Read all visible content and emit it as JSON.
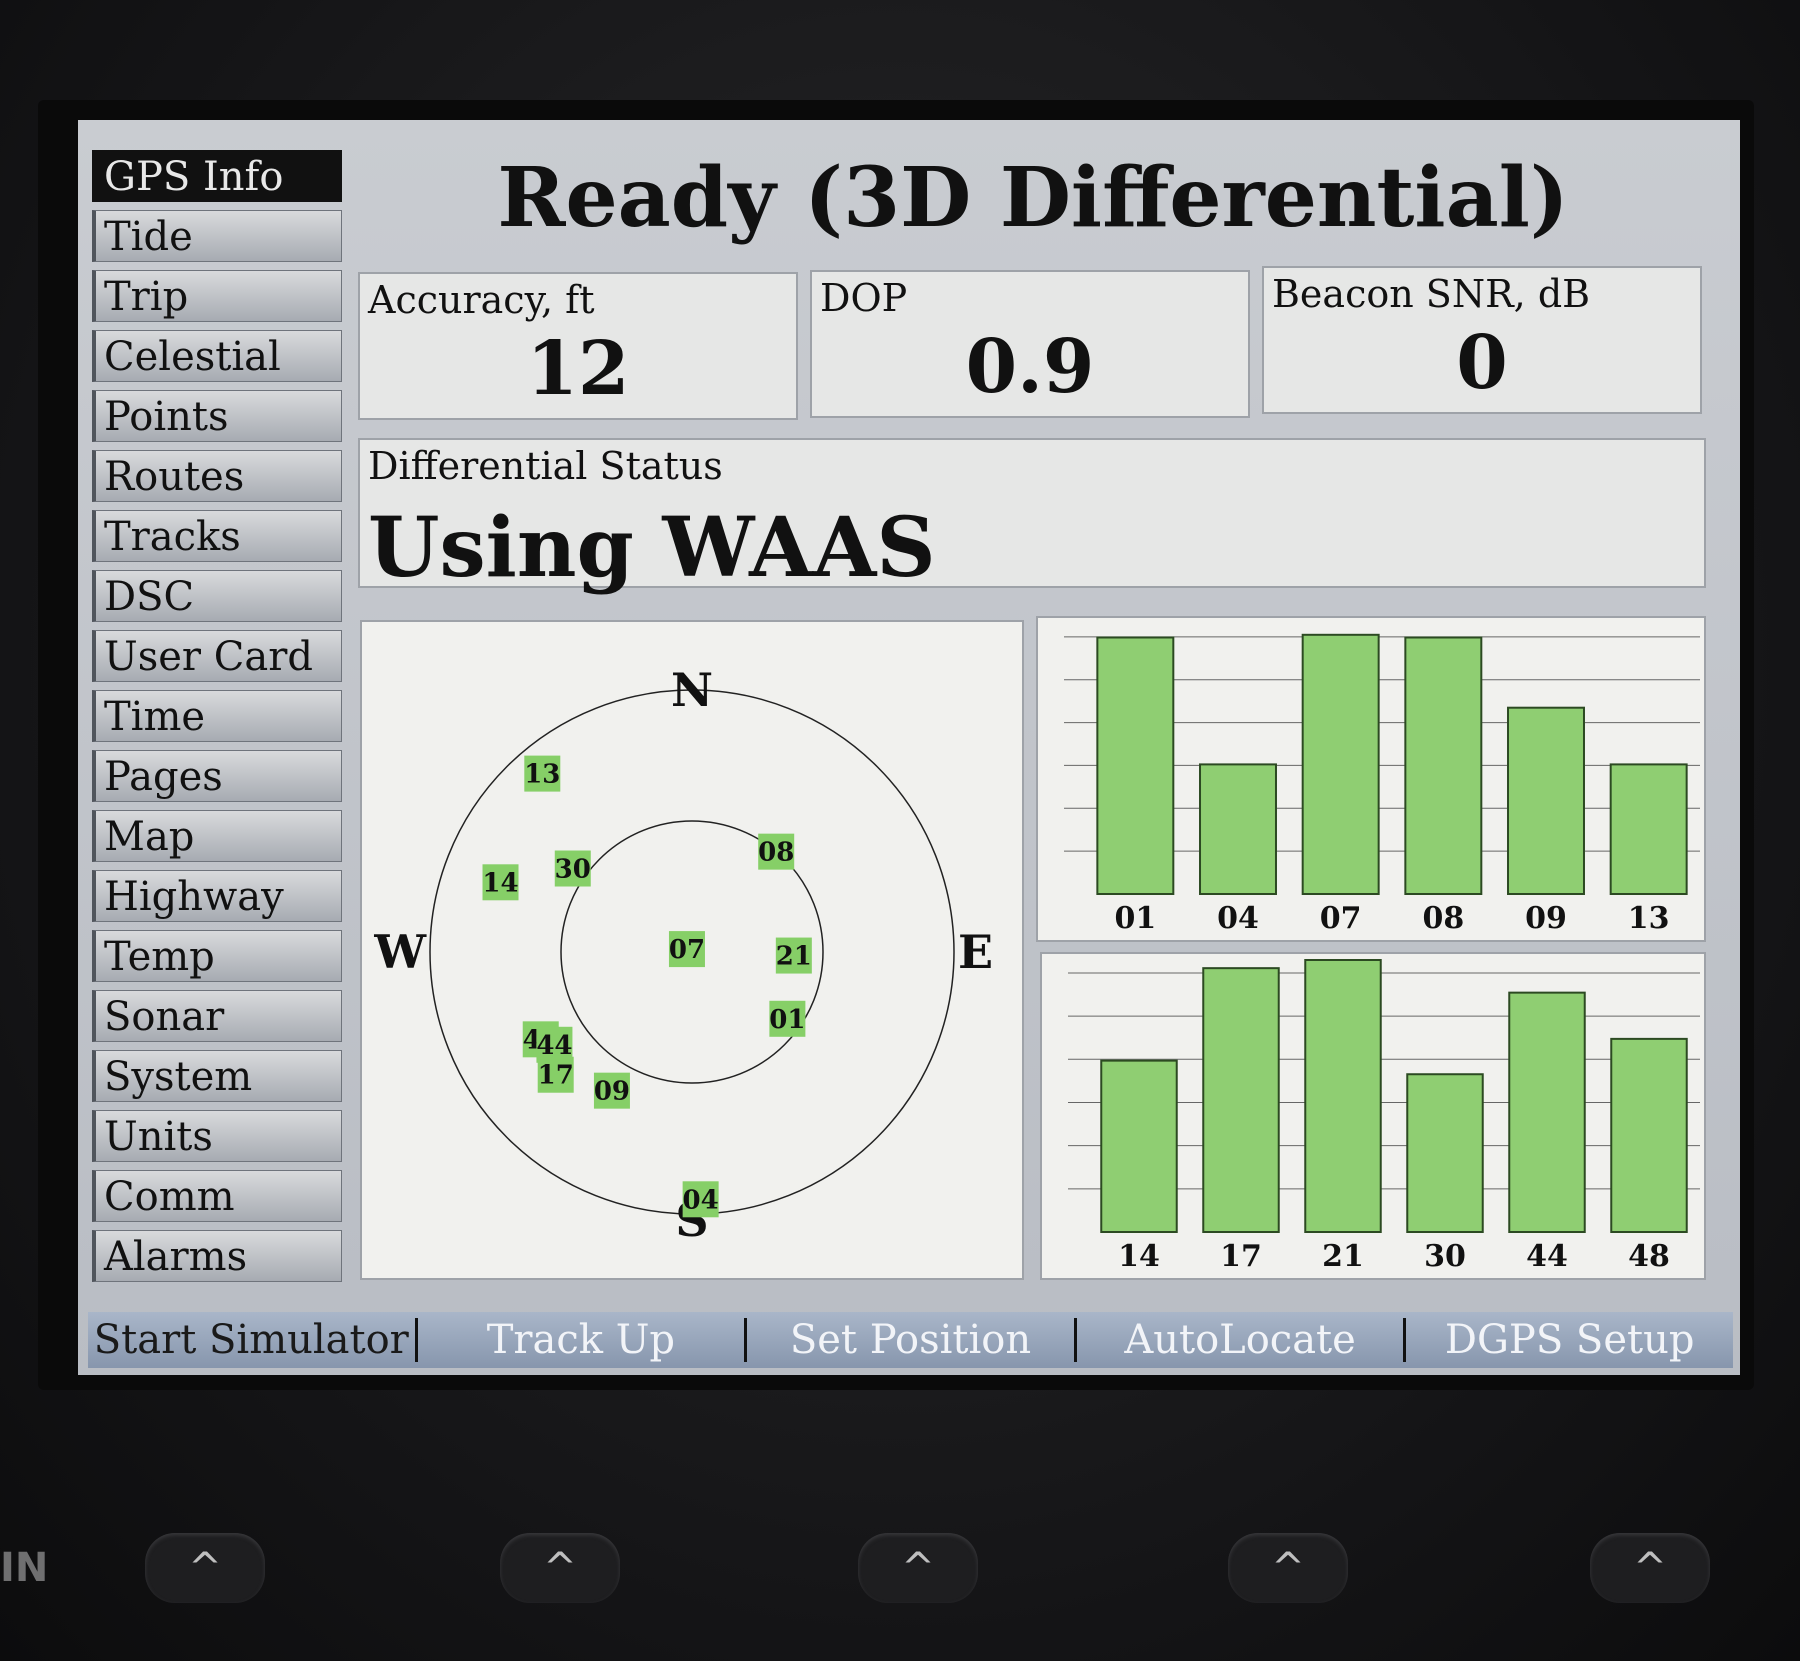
{
  "sidebar": {
    "items": [
      {
        "label": "GPS Info",
        "active": true
      },
      {
        "label": "Tide"
      },
      {
        "label": "Trip"
      },
      {
        "label": "Celestial"
      },
      {
        "label": "Points"
      },
      {
        "label": "Routes"
      },
      {
        "label": "Tracks"
      },
      {
        "label": "DSC"
      },
      {
        "label": "User Card"
      },
      {
        "label": "Time"
      },
      {
        "label": "Pages"
      },
      {
        "label": "Map"
      },
      {
        "label": "Highway"
      },
      {
        "label": "Temp"
      },
      {
        "label": "Sonar"
      },
      {
        "label": "System"
      },
      {
        "label": "Units"
      },
      {
        "label": "Comm"
      },
      {
        "label": "Alarms"
      }
    ]
  },
  "status": {
    "title": "Ready (3D Differential)"
  },
  "accuracy": {
    "label": "Accuracy, ft",
    "value": "12"
  },
  "dop": {
    "label": "DOP",
    "value": "0.9"
  },
  "beacon": {
    "label": "Beacon SNR, dB",
    "value": "0"
  },
  "differential": {
    "label": "Differential Status",
    "value": "Using WAAS"
  },
  "skyview": {
    "compass": {
      "n": "N",
      "e": "E",
      "s": "S",
      "w": "W"
    },
    "satellites": [
      {
        "id": "13",
        "elevation": 10,
        "azimuth": 320
      },
      {
        "id": "14",
        "elevation": 20,
        "azimuth": 290
      },
      {
        "id": "30",
        "elevation": 40,
        "azimuth": 305
      },
      {
        "id": "08",
        "elevation": 45,
        "azimuth": 40
      },
      {
        "id": "07",
        "elevation": 88,
        "azimuth": 300
      },
      {
        "id": "21",
        "elevation": 55,
        "azimuth": 92
      },
      {
        "id": "48",
        "elevation": 30,
        "azimuth": 240
      },
      {
        "id": "44",
        "elevation": 33,
        "azimuth": 236
      },
      {
        "id": "17",
        "elevation": 27,
        "azimuth": 228
      },
      {
        "id": "01",
        "elevation": 50,
        "azimuth": 125
      },
      {
        "id": "09",
        "elevation": 35,
        "azimuth": 210
      },
      {
        "id": "04",
        "elevation": 5,
        "azimuth": 178
      }
    ]
  },
  "chart_data": [
    {
      "type": "bar",
      "categories": [
        "01",
        "04",
        "07",
        "08",
        "09",
        "13"
      ],
      "values": [
        95,
        48,
        96,
        95,
        69,
        48
      ],
      "ylim": [
        0,
        100
      ],
      "grid": true
    },
    {
      "type": "bar",
      "categories": [
        "14",
        "17",
        "21",
        "30",
        "44",
        "48"
      ],
      "values": [
        63,
        97,
        100,
        58,
        88,
        71
      ],
      "ylim": [
        0,
        100
      ],
      "grid": true
    }
  ],
  "softkeys": [
    "Start Simulator",
    "Track Up",
    "Set Position",
    "AutoLocate",
    "DGPS Setup"
  ],
  "hardware": {
    "button_glyph": "^",
    "brand_fragment": "IN"
  },
  "colors": {
    "bar_fill": "#8fce72",
    "bar_stroke": "#2c4a22",
    "sat_fill": "#86cf67",
    "screen_bg": "#c3c6cb"
  }
}
